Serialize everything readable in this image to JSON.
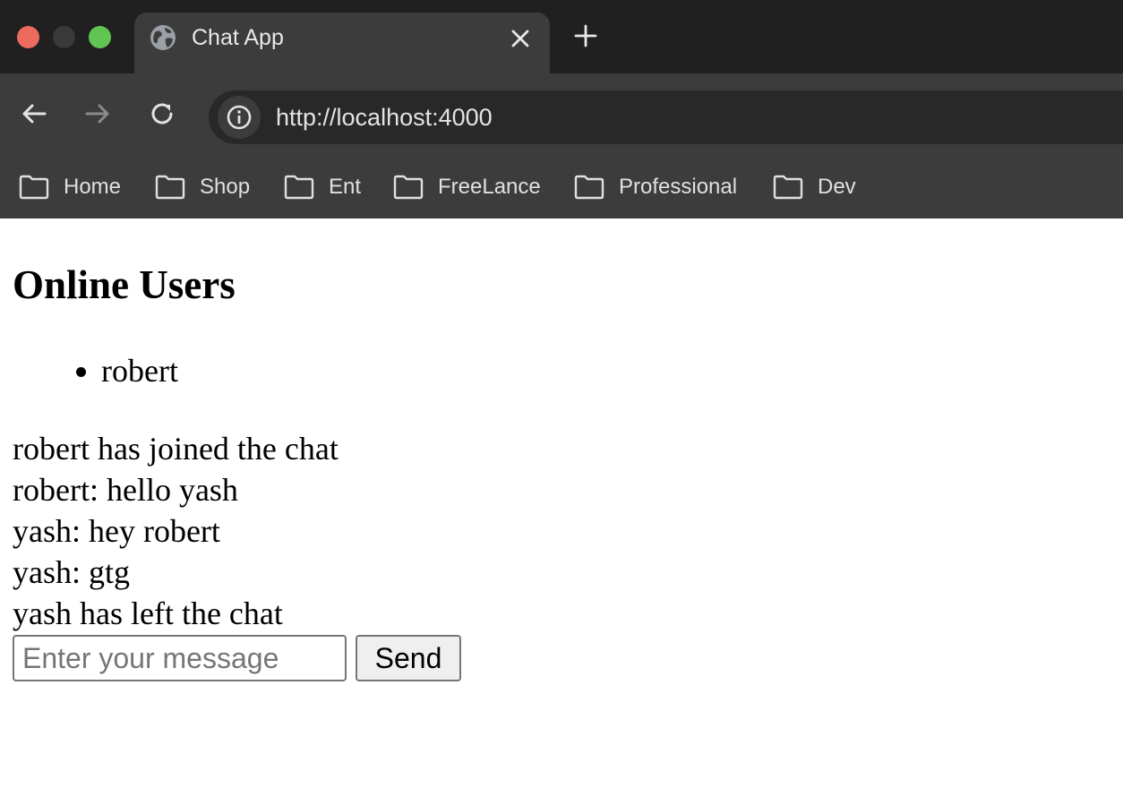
{
  "browser": {
    "tab": {
      "title": "Chat App",
      "icon": "globe-icon"
    },
    "address_bar": {
      "url": "http://localhost:4000",
      "icon": "info-icon"
    },
    "bookmarks": [
      {
        "label": "Home",
        "icon": "folder-icon"
      },
      {
        "label": "Shop",
        "icon": "folder-icon"
      },
      {
        "label": "Ent",
        "icon": "folder-icon"
      },
      {
        "label": "FreeLance",
        "icon": "folder-icon"
      },
      {
        "label": "Professional",
        "icon": "folder-icon"
      },
      {
        "label": "Dev",
        "icon": "folder-icon"
      }
    ],
    "colors": {
      "tabstrip": "#202020",
      "toolbar": "#3c3c3c",
      "omnibox": "#282828",
      "close_dot": "#ed6a5e",
      "zoom_dot": "#61c554"
    }
  },
  "page": {
    "heading": "Online Users",
    "online_users": [
      "robert"
    ],
    "messages": [
      "robert has joined the chat",
      "robert: hello yash",
      "yash: hey robert",
      "yash: gtg",
      "yash has left the chat"
    ],
    "input": {
      "placeholder": "Enter your message",
      "value": ""
    },
    "send_label": "Send"
  }
}
